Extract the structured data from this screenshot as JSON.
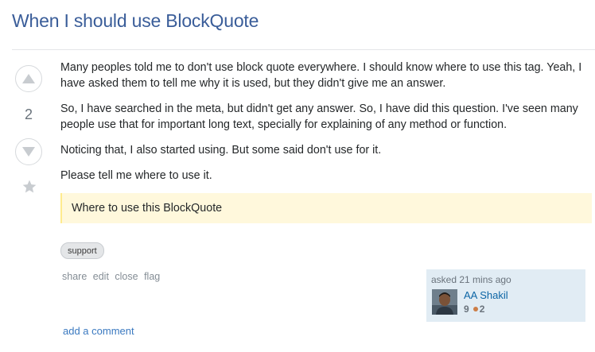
{
  "question": {
    "title": "When I should use BlockQuote",
    "vote_count": "2",
    "paragraphs": [
      "Many peoples told me to don't use block quote everywhere. I should know where to use this tag. Yeah, I have asked them to tell me why it is used, but they didn't give me an answer.",
      "So, I have searched in the meta, but didn't get any answer. So, I have did this question. I've seen many people use that for important long text, specially for explaining of any method or function.",
      "Noticing that, I also started using. But some said don't use for it.",
      "Please tell me where to use it."
    ],
    "blockquote": "Where to use this BlockQuote",
    "tags": [
      "support"
    ]
  },
  "post_menu": {
    "share": "share",
    "edit": "edit",
    "close": "close",
    "flag": "flag"
  },
  "owner": {
    "action_time": "asked 21 mins ago",
    "name": "AA Shakil",
    "reputation": "9",
    "bronze_badges": "2"
  },
  "comments": {
    "add_label": "add a comment"
  },
  "icons": {
    "upvote": "triangle-up-icon",
    "downvote": "triangle-down-icon",
    "favorite": "star-icon"
  },
  "colors": {
    "title": "#3a5d99",
    "blockquote_bg": "#fff8dc",
    "owner_card_bg": "#e1ecf4",
    "link": "#0c65a5",
    "bronze": "#cc7e48"
  }
}
